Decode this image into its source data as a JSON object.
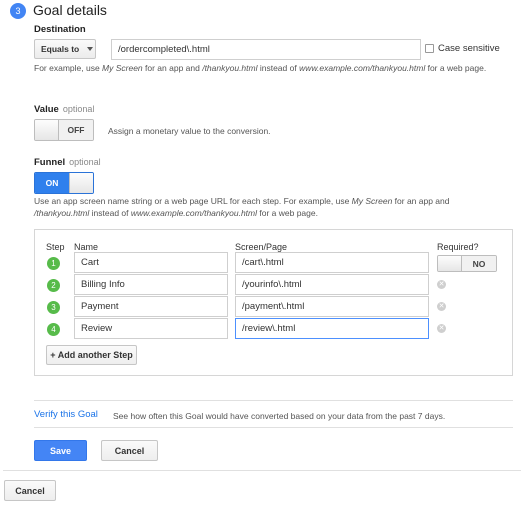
{
  "header": {
    "step_number": "3",
    "title": "Goal details"
  },
  "destination": {
    "label": "Destination",
    "match_type": "Equals to",
    "value": "/ordercompleted\\.html",
    "case_sensitive_label": "Case sensitive",
    "help_prefix": "For example, use ",
    "help_em1": "My Screen",
    "help_mid": " for an app and ",
    "help_em2": "/thankyou.html",
    "help_mid2": " instead of ",
    "help_em3": "www.example.com/thankyou.html",
    "help_suffix": " for a web page."
  },
  "value": {
    "label": "Value",
    "optional": "optional",
    "toggle": "OFF",
    "description": "Assign a monetary value to the conversion."
  },
  "funnel": {
    "label": "Funnel",
    "optional": "optional",
    "toggle": "ON",
    "help_prefix": "Use an app screen name string or a web page URL for each step. For example, use ",
    "help_em1": "My Screen",
    "help_mid": " for an app and ",
    "help_em2": "/thankyou.html",
    "help_mid2": " instead of ",
    "help_em3": "www.example.com/thankyou.html",
    "help_suffix": " for a web page.",
    "headers": {
      "step": "Step",
      "name": "Name",
      "screen": "Screen/Page",
      "required": "Required?"
    },
    "steps": [
      {
        "num": "1",
        "name": "Cart",
        "screen": "/cart\\.html"
      },
      {
        "num": "2",
        "name": "Billing Info",
        "screen": "/yourinfo\\.html"
      },
      {
        "num": "3",
        "name": "Payment",
        "screen": "/payment\\.html"
      },
      {
        "num": "4",
        "name": "Review",
        "screen": "/review\\.html"
      }
    ],
    "required_toggle": "NO",
    "add_step": "+ Add another Step"
  },
  "verify": {
    "link": "Verify this Goal",
    "description": "See how often this Goal would have converted based on your data from the past 7 days."
  },
  "actions": {
    "save": "Save",
    "cancel": "Cancel"
  },
  "footer": {
    "cancel": "Cancel"
  },
  "colors": {
    "accent": "#4285f4",
    "step_green": "#57bb4a",
    "link": "#1a73e8"
  }
}
